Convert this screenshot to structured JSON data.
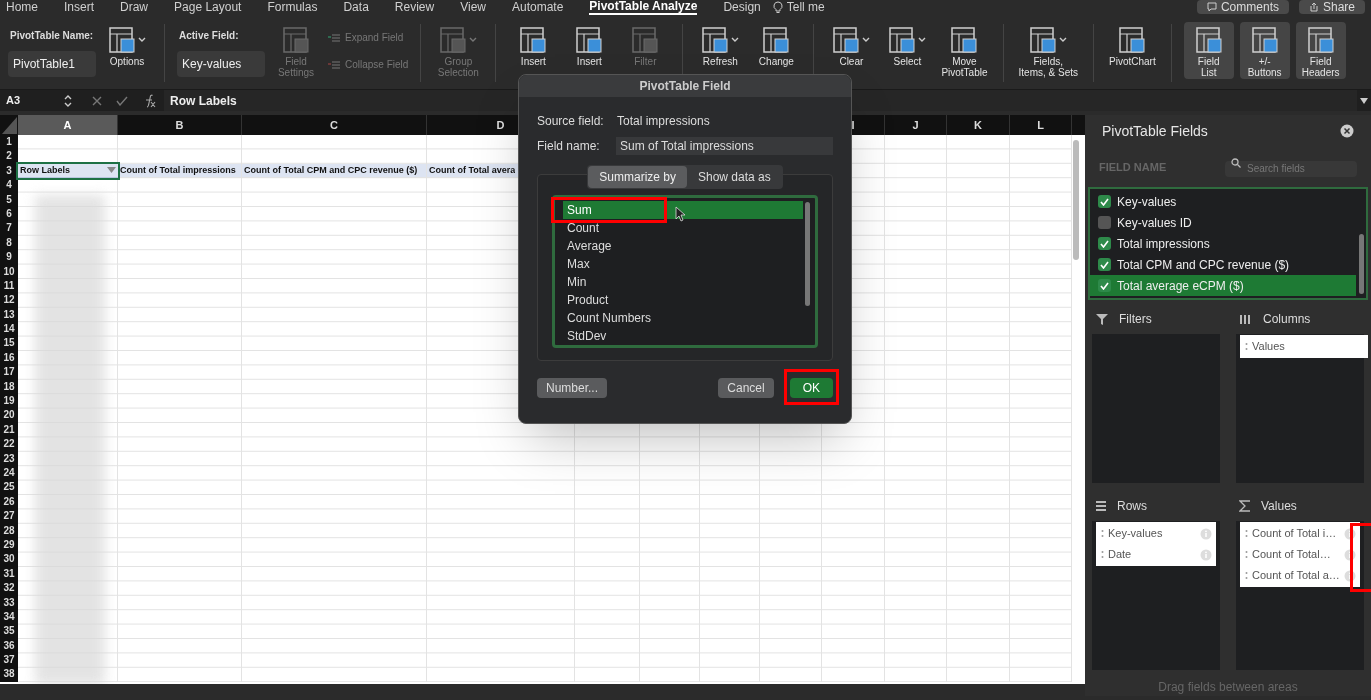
{
  "menu_tabs": [
    {
      "label": "Home",
      "selected": false
    },
    {
      "label": "Insert",
      "selected": false
    },
    {
      "label": "Draw",
      "selected": false
    },
    {
      "label": "Page Layout",
      "selected": false
    },
    {
      "label": "Formulas",
      "selected": false
    },
    {
      "label": "Data",
      "selected": false
    },
    {
      "label": "Review",
      "selected": false
    },
    {
      "label": "View",
      "selected": false
    },
    {
      "label": "Automate",
      "selected": false
    },
    {
      "label": "PivotTable Analyze",
      "selected": true
    },
    {
      "label": "Design",
      "selected": false
    }
  ],
  "tell_me": "Tell me",
  "top_buttons": [
    {
      "label": "Comments",
      "kind": "comments"
    },
    {
      "label": "Share",
      "kind": "share"
    }
  ],
  "ribbon": [
    {
      "items": [
        {
          "kind": "field",
          "label": "PivotTable Name:",
          "value": "PivotTable1"
        },
        {
          "kind": "button",
          "lines": [
            "Options"
          ],
          "caret": true,
          "disabled": false,
          "selected": false
        }
      ]
    },
    {
      "items": [
        {
          "kind": "field",
          "label": "Active Field:",
          "value": "Key-values"
        },
        {
          "kind": "button",
          "lines": [
            "Field",
            "Settings"
          ],
          "caret": false,
          "disabled": true,
          "selected": false
        },
        {
          "kind": "stack",
          "items": [
            {
              "label": "Expand Field",
              "disabled": true
            },
            {
              "label": "Collapse Field",
              "disabled": true
            }
          ]
        }
      ]
    },
    {
      "items": [
        {
          "kind": "button",
          "lines": [
            "Group",
            "Selection"
          ],
          "caret": true,
          "disabled": true,
          "selected": false
        }
      ]
    },
    {
      "items": [
        {
          "kind": "button",
          "lines": [
            "Insert"
          ],
          "caret": false,
          "disabled": false,
          "selected": false
        },
        {
          "kind": "button",
          "lines": [
            "Insert"
          ],
          "caret": false,
          "disabled": false,
          "selected": false
        },
        {
          "kind": "button",
          "lines": [
            "Filter"
          ],
          "caret": false,
          "disabled": true,
          "selected": false
        }
      ]
    },
    {
      "items": [
        {
          "kind": "button",
          "lines": [
            "Refresh"
          ],
          "caret": true,
          "disabled": false,
          "selected": false
        },
        {
          "kind": "button",
          "lines": [
            "Change"
          ],
          "caret": false,
          "disabled": false,
          "selected": false
        }
      ]
    },
    {
      "items": [
        {
          "kind": "button",
          "lines": [
            "Clear"
          ],
          "caret": true,
          "disabled": false,
          "selected": false
        },
        {
          "kind": "button",
          "lines": [
            "Select"
          ],
          "caret": true,
          "disabled": false,
          "selected": false
        },
        {
          "kind": "button",
          "lines": [
            "Move",
            "PivotTable"
          ],
          "caret": false,
          "disabled": false,
          "selected": false
        }
      ]
    },
    {
      "items": [
        {
          "kind": "button",
          "lines": [
            "Fields,",
            "Items, & Sets"
          ],
          "caret": true,
          "disabled": false,
          "selected": false
        }
      ]
    },
    {
      "items": [
        {
          "kind": "button",
          "lines": [
            "PivotChart"
          ],
          "caret": false,
          "disabled": false,
          "selected": false
        }
      ]
    },
    {
      "items": [
        {
          "kind": "button",
          "lines": [
            "Field",
            "List"
          ],
          "caret": false,
          "disabled": false,
          "selected": true
        },
        {
          "kind": "button",
          "lines": [
            "+/-",
            "Buttons"
          ],
          "caret": false,
          "disabled": false,
          "selected": true
        },
        {
          "kind": "button",
          "lines": [
            "Field",
            "Headers"
          ],
          "caret": false,
          "disabled": false,
          "selected": true
        }
      ]
    }
  ],
  "formula_bar": {
    "name_box": "A3",
    "formula": "Row Labels"
  },
  "sheet": {
    "columns": [
      {
        "label": "A",
        "selected": true
      },
      {
        "label": "B",
        "selected": false
      },
      {
        "label": "C",
        "selected": false
      },
      {
        "label": "D",
        "selected": false
      },
      {
        "label": "I",
        "selected": false
      },
      {
        "label": "J",
        "selected": false
      },
      {
        "label": "K",
        "selected": false
      },
      {
        "label": "L",
        "selected": false
      }
    ],
    "row_numbers": [
      "1",
      "2",
      "3",
      "4",
      "5",
      "6",
      "7",
      "8",
      "9",
      "10",
      "11",
      "12",
      "13",
      "14",
      "15",
      "16",
      "17",
      "18",
      "19",
      "20",
      "21",
      "22",
      "23",
      "24",
      "25",
      "26",
      "27",
      "28",
      "29",
      "30",
      "31",
      "32",
      "33",
      "34",
      "35",
      "36",
      "37",
      "38"
    ],
    "header_cells": [
      {
        "text": "Row Labels",
        "kind": "filter",
        "selected": true
      },
      {
        "text": "Count of Total impressions",
        "kind": "plain",
        "selected": false
      },
      {
        "text": "Count of Total CPM and CPC revenue ($)",
        "kind": "plain",
        "selected": false
      },
      {
        "text": "Count of Total avera",
        "kind": "plain",
        "selected": false
      }
    ]
  },
  "dialog": {
    "title": "PivotTable Field",
    "source_label": "Source field:",
    "source_value": "Total impressions",
    "name_label": "Field name:",
    "name_value": "Sum of Total impressions",
    "tabs": [
      {
        "label": "Summarize by",
        "selected": true
      },
      {
        "label": "Show data as",
        "selected": false
      }
    ],
    "functions": [
      {
        "label": "Sum",
        "selected": true,
        "highlighted": true
      },
      {
        "label": "Count",
        "selected": false,
        "highlighted": false
      },
      {
        "label": "Average",
        "selected": false,
        "highlighted": false
      },
      {
        "label": "Max",
        "selected": false,
        "highlighted": false
      },
      {
        "label": "Min",
        "selected": false,
        "highlighted": false
      },
      {
        "label": "Product",
        "selected": false,
        "highlighted": false
      },
      {
        "label": "Count Numbers",
        "selected": false,
        "highlighted": false
      },
      {
        "label": "StdDev",
        "selected": false,
        "highlighted": false
      }
    ],
    "buttons": [
      {
        "label": "Number...",
        "kind": "secondary",
        "highlighted": false
      },
      {
        "label": "Cancel",
        "kind": "secondary",
        "highlighted": false
      },
      {
        "label": "OK",
        "kind": "default",
        "highlighted": true
      }
    ]
  },
  "panel": {
    "title": "PivotTable Fields",
    "field_name_label": "FIELD NAME",
    "search": {
      "placeholder": "Search fields"
    },
    "fields": [
      {
        "label": "Key-values",
        "checked": true,
        "selected": false
      },
      {
        "label": "Key-values ID",
        "checked": false,
        "selected": false
      },
      {
        "label": "Total impressions",
        "checked": true,
        "selected": false
      },
      {
        "label": "Total CPM and CPC revenue ($)",
        "checked": true,
        "selected": false
      },
      {
        "label": "Total average eCPM ($)",
        "checked": true,
        "selected": true
      }
    ],
    "areas": [
      {
        "kind": "filters",
        "title": "Filters",
        "highlighted": false
      },
      {
        "kind": "columns",
        "title": "Columns",
        "highlighted": false,
        "items": [
          {
            "label": "Values",
            "info": false
          }
        ]
      },
      {
        "kind": "rows",
        "title": "Rows",
        "highlighted": false,
        "items": [
          {
            "label": "Key-values",
            "info": true
          },
          {
            "label": "Date",
            "info": true
          }
        ]
      },
      {
        "kind": "values",
        "title": "Values",
        "highlighted": true,
        "items": [
          {
            "label": "Count of Total i…",
            "info": true
          },
          {
            "label": "Count of Total…",
            "info": true
          },
          {
            "label": "Count of Total a…",
            "info": true
          }
        ]
      }
    ],
    "footer": "Drag fields between areas"
  }
}
